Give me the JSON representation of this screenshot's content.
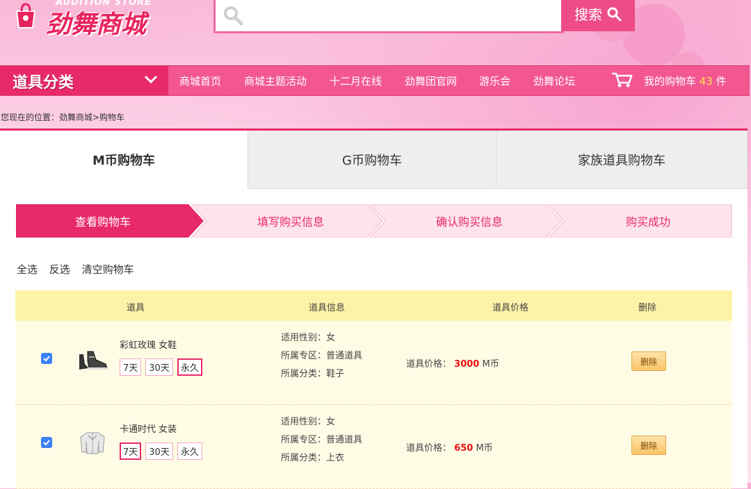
{
  "logo": {
    "subtitle": "AUDITION STORE",
    "name": "劲舞商城"
  },
  "search": {
    "placeholder": "",
    "button_label": "搜索"
  },
  "nav": {
    "category_label": "道具分类",
    "items": [
      "商城首页",
      "商城主题活动",
      "十二月在线",
      "劲舞团官网",
      "游乐会",
      "劲舞论坛"
    ],
    "cart_label": "我的购物车",
    "cart_count": "43",
    "cart_unit": "件"
  },
  "breadcrumb": "您现在的位置：劲舞商城>购物车",
  "tabs": [
    "M币购物车",
    "G币购物车",
    "家族道具购物车"
  ],
  "steps": [
    "查看购物车",
    "填写购买信息",
    "确认购买信息",
    "购买成功"
  ],
  "actions": [
    "全选",
    "反选",
    "清空购物车"
  ],
  "table": {
    "headers": [
      "道具",
      "道具信息",
      "道具价格",
      "删除"
    ],
    "rows": [
      {
        "name": "彩虹玫瑰 女鞋",
        "durations": [
          "7天",
          "30天",
          "永久"
        ],
        "selected_duration": "永久",
        "gender": "适用性别：女",
        "zone": "所属专区：普通道具",
        "category": "所属分类：鞋子",
        "price_label": "道具价格：",
        "price": "3000",
        "currency": "M币",
        "delete_label": "删除",
        "checked": true
      },
      {
        "name": "卡通时代 女装",
        "durations": [
          "7天",
          "30天",
          "永久"
        ],
        "selected_duration": "7天",
        "gender": "适用性别：女",
        "zone": "所属专区：普通道具",
        "category": "所属分类：上衣",
        "price_label": "道具价格：",
        "price": "650",
        "currency": "M币",
        "delete_label": "删除",
        "checked": true
      }
    ]
  },
  "colors": {
    "brand": "#e8296a",
    "nav": "#f25790",
    "price": "#e8110f",
    "cart_count": "#ffe34d"
  },
  "icons": [
    "shopping-bag-icon",
    "search-icon",
    "chevron-down-icon",
    "cart-icon",
    "checkbox-icon",
    "shoe-icon",
    "jacket-icon"
  ]
}
